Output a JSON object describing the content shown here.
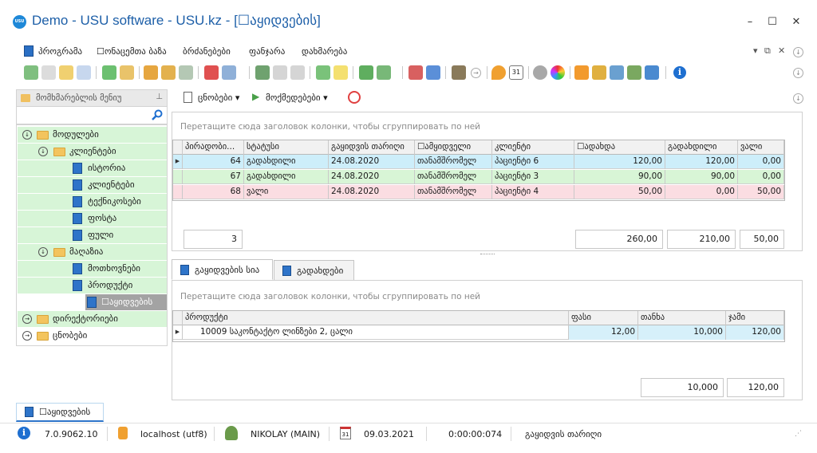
{
  "window": {
    "title": "Demo - USU software - USU.kz - [☐აყიდვების]",
    "logo_text": "USU",
    "controls": [
      "–",
      "☐",
      "✕"
    ]
  },
  "menu": {
    "items": [
      "პროგრამა",
      "☐ონაცემთა ბაზა",
      "ბრძანებები",
      "ფანჯარა",
      "დახმარება"
    ],
    "mdi_controls": [
      "▾",
      "⧉",
      "✕"
    ]
  },
  "sidebar": {
    "header": "მომხმარებლის მენიუ",
    "tree": [
      {
        "label": "მოდულები",
        "level": 0,
        "type": "folder",
        "expanded": true,
        "highlight": true
      },
      {
        "label": "კლიენტები",
        "level": 1,
        "type": "folder",
        "expanded": true,
        "highlight": true
      },
      {
        "label": "ისტორია",
        "level": 2,
        "type": "doc",
        "highlight": true
      },
      {
        "label": "კლიენტები",
        "level": 2,
        "type": "doc",
        "highlight": true
      },
      {
        "label": "ტექნიკოსები",
        "level": 2,
        "type": "doc",
        "highlight": true
      },
      {
        "label": "ფოსტა",
        "level": 2,
        "type": "doc",
        "highlight": true
      },
      {
        "label": "ფული",
        "level": 2,
        "type": "doc",
        "highlight": true
      },
      {
        "label": "მაღაზია",
        "level": 1,
        "type": "folder",
        "expanded": true,
        "highlight": true
      },
      {
        "label": "მოთხოვნები",
        "level": 2,
        "type": "doc",
        "highlight": true
      },
      {
        "label": "პროდუქტი",
        "level": 2,
        "type": "doc",
        "highlight": true
      },
      {
        "label": "☐აყიდვების",
        "level": 2,
        "type": "doc",
        "selected": true
      },
      {
        "label": "დირექტორიები",
        "level": 0,
        "type": "folder",
        "expanded": false,
        "highlight": true
      },
      {
        "label": "ცნობები",
        "level": 0,
        "type": "folder",
        "expanded": false,
        "highlight": false
      }
    ]
  },
  "main_toolbar": {
    "reports": "ცნობები",
    "actions": "მოქმედებები"
  },
  "top_panel": {
    "group_hint": "Перетащите сюда заголовок колонки, чтобы сгруппировать по ней",
    "columns": [
      "პირადობი...",
      "სტატუსი",
      "გაყიდვის თარიღი",
      "☐ამყიდველი",
      "კლიენტი",
      "☐ადახდა",
      "გადახდილი",
      "ვალი"
    ],
    "rows": [
      {
        "id": "64",
        "status": "გადახდილი",
        "date": "24.08.2020",
        "seller": "თანამშრომელ",
        "client": "პაციენტი 6",
        "due": "120,00",
        "paid": "120,00",
        "debt": "0,00",
        "color": "blue",
        "current": true
      },
      {
        "id": "67",
        "status": "გადახდილი",
        "date": "24.08.2020",
        "seller": "თანამშრომელ",
        "client": "პაციენტი 3",
        "due": "90,00",
        "paid": "90,00",
        "debt": "0,00",
        "color": "green",
        "current": false
      },
      {
        "id": "68",
        "status": "ვალი",
        "date": "24.08.2020",
        "seller": "თანამშრომელ",
        "client": "პაციენტი 4",
        "due": "50,00",
        "paid": "0,00",
        "debt": "50,00",
        "color": "pink",
        "current": false
      }
    ],
    "totals": {
      "count": "3",
      "due": "260,00",
      "paid": "210,00",
      "debt": "50,00"
    }
  },
  "tabs": [
    {
      "label": "გაყიდვების სია",
      "active": true
    },
    {
      "label": "გადახდები",
      "active": false
    }
  ],
  "bottom_panel": {
    "group_hint": "Перетащите сюда заголовок колонки, чтобы сгруппировать по ней",
    "columns": [
      "პროდუქტი",
      "ფასი",
      "თანხა",
      "ჯამი"
    ],
    "rows": [
      {
        "product": "10009 საკონტაქტო ლინზები 2, ცალი",
        "price": "12,00",
        "amount": "10,000",
        "sum": "120,00"
      }
    ],
    "totals": {
      "amount": "10,000",
      "sum": "120,00"
    }
  },
  "bottom_tab": "☐აყიდვების",
  "status_bar": {
    "version": "7.0.9062.10",
    "db": "localhost (utf8)",
    "user": "NIKOLAY (MAIN)",
    "date": "09.03.2021",
    "timer": "0:00:00:074",
    "field": "გაყიდვის თარიღი"
  },
  "colors": {
    "accent": "#2e74c9",
    "title": "#1d5fa8",
    "row_blue": "#cdeefa",
    "row_green": "#d8f5d6",
    "row_pink": "#fbdde2"
  }
}
